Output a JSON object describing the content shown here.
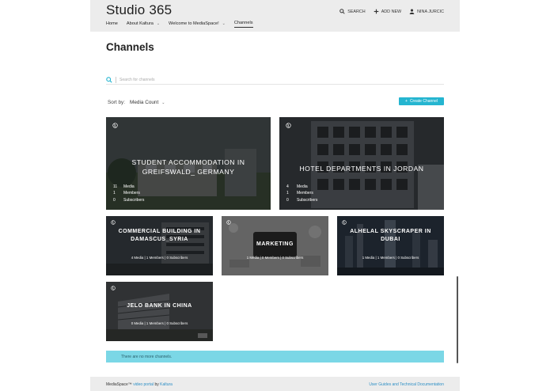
{
  "header": {
    "site_title": "Studio 365",
    "actions": [
      {
        "label": "SEARCH",
        "icon": "search-icon"
      },
      {
        "label": "ADD NEW",
        "icon": "plus-icon"
      },
      {
        "label": "NINA JURCIC",
        "icon": "user-icon"
      }
    ],
    "nav": [
      {
        "label": "Home"
      },
      {
        "label": "About Kaltura",
        "has_dropdown": true
      },
      {
        "label": "Welcome to MediaSpace!",
        "has_dropdown": true
      },
      {
        "label": "Channels",
        "active": true
      }
    ]
  },
  "page_title": "Channels",
  "search": {
    "placeholder": "Search for channels",
    "value": ""
  },
  "sort": {
    "label": "Sort by:",
    "value": "Media Count"
  },
  "create_button": {
    "label": "Create Channel",
    "icon": "plus-icon"
  },
  "channels": [
    {
      "title": "STUDENT ACCOMMODATION IN GREIFSWALD_ GERMANY",
      "media": "11",
      "members": "1",
      "subscribers": "0",
      "media_label": "Media",
      "members_label": "Members",
      "subscribers_label": "Subscribers"
    },
    {
      "title": "HOTEL DEPARTMENTS IN JORDAN",
      "media": "4",
      "members": "1",
      "subscribers": "0",
      "media_label": "Media",
      "members_label": "Members",
      "subscribers_label": "Subscribers"
    },
    {
      "title": "COMMERCIAL BUILDING IN DAMASCUS_SYRIA",
      "stats": "4 Media | 1 Members | 0 Subscribers"
    },
    {
      "title": "MARKETING",
      "stats": "1 Media | 0 Members | 0 Subscribers"
    },
    {
      "title": "ALHELAL SKYSCRAPER IN DUBAI",
      "stats": "1 Media | 1 Members | 0 Subscribers"
    },
    {
      "title": "JELO BANK IN CHINA",
      "stats": "0 Media | 1 Members | 0 Subscribers"
    }
  ],
  "notice": "There are no more channels.",
  "footer": {
    "left_prefix": "MediaSpace™",
    "left_link": "video portal",
    "left_by": "by",
    "left_brand": "Kaltura",
    "right_link": "User Guides and Technical Documentation"
  },
  "colors": {
    "accent": "#25b5d0",
    "notice_bg": "#7bd7e6",
    "header_bg": "#ececec"
  }
}
